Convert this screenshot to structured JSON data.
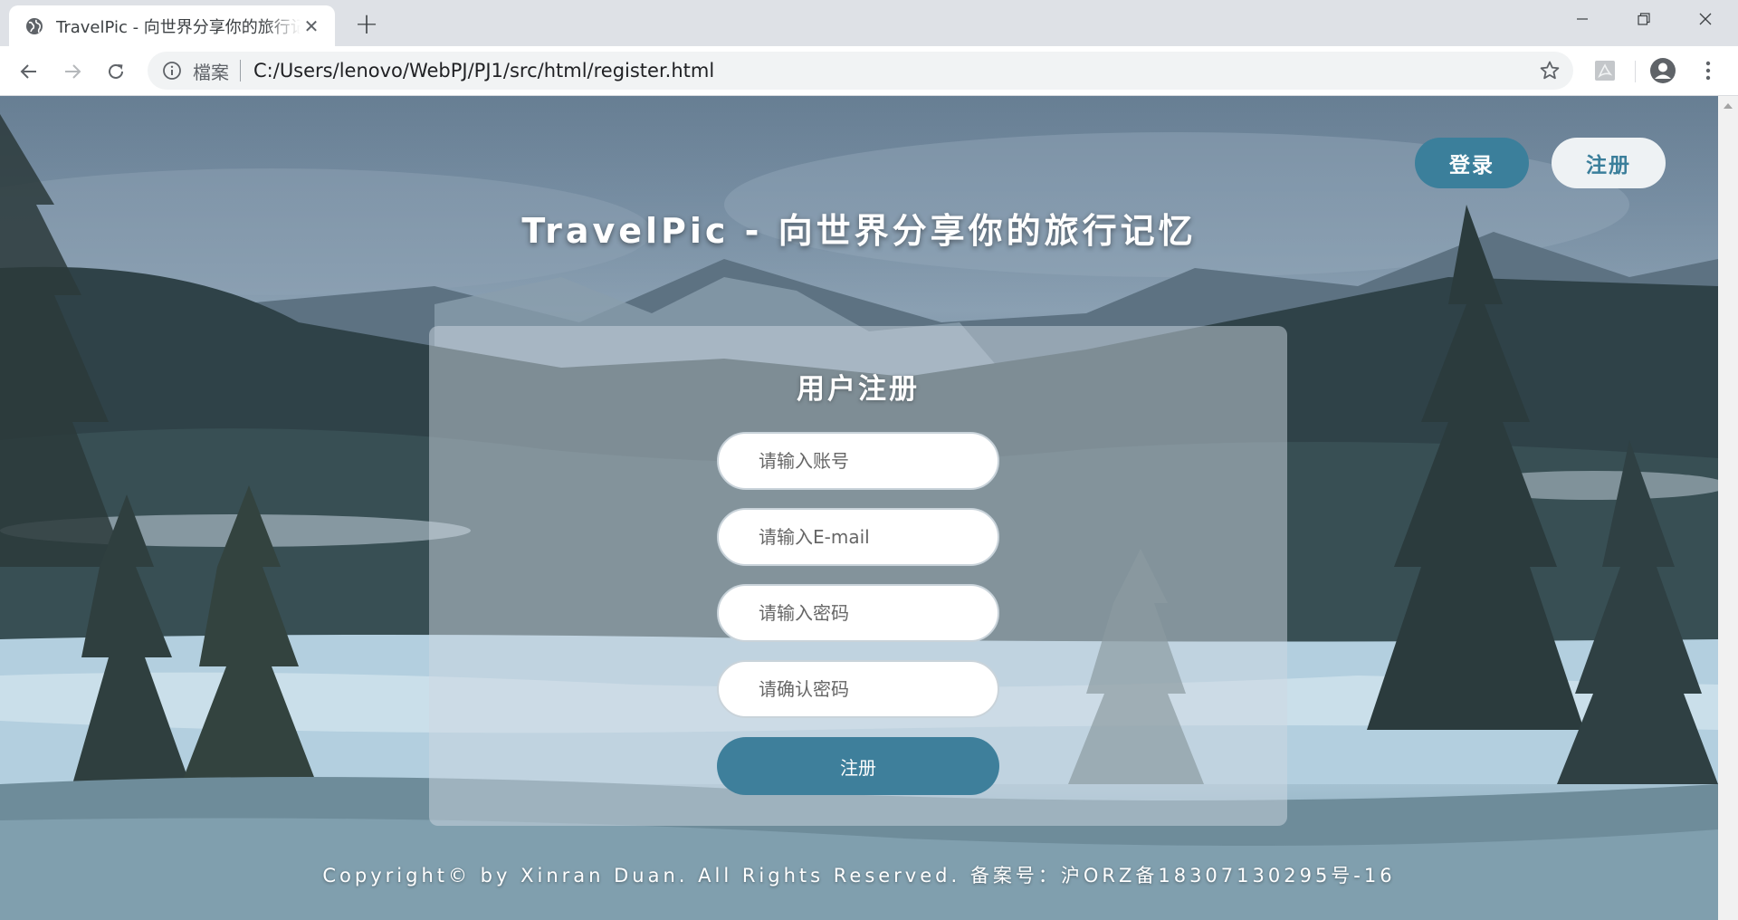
{
  "browser": {
    "tab_title": "TravelPic - 向世界分享你的旅行记忆",
    "tab_close": "✕",
    "new_tab": "+",
    "site_label": "檔案",
    "url": "C:/Users/lenovo/WebPJ/PJ1/src/html/register.html",
    "icons": [
      "globe-icon",
      "back-arrow-icon",
      "forward-arrow-icon",
      "reload-icon",
      "info-icon",
      "star-icon",
      "pdf-extension-icon",
      "profile-icon",
      "menu-icon",
      "minimize-icon",
      "restore-icon",
      "close-icon"
    ]
  },
  "page": {
    "nav": {
      "login_label": "登录",
      "register_label": "注册"
    },
    "site_title": "TravelPic - 向世界分享你的旅行记忆",
    "form": {
      "title": "用户注册",
      "account_placeholder": "请输入账号",
      "email_placeholder": "请输入E-mail",
      "password_placeholder": "请输入密码",
      "confirm_placeholder": "请确认密码",
      "submit_label": "注册"
    },
    "footer": "Copyright© by Xinran Duan. All Rights Reserved. 备案号：沪ORZ备18307130295号-16",
    "colors": {
      "accent": "#3b7f9b",
      "light_button": "#eef2f4",
      "panel": "rgba(205,215,225,0.50)"
    }
  }
}
